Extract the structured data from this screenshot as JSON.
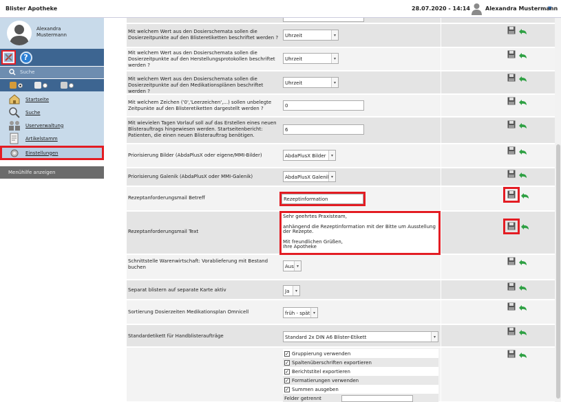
{
  "app_title": "Blister Apotheke",
  "header": {
    "datetime": "28.07.2020 - 14:14",
    "user_name": "Alexandra Mustermann"
  },
  "sidebar": {
    "profile_name_line1": "Alexandra",
    "profile_name_line2": "Mustermann",
    "search_label": "Suche",
    "nav": [
      {
        "label": "Startseite",
        "icon": "home-icon"
      },
      {
        "label": "Suche",
        "icon": "magnifier-icon"
      },
      {
        "label": "Userverwaltung",
        "icon": "users-icon"
      },
      {
        "label": "Artikelstamm",
        "icon": "article-icon"
      },
      {
        "label": "Einstellungen",
        "icon": "settings-icon"
      }
    ],
    "help_toggle": "Menühilfe anzeigen"
  },
  "settings": [
    {
      "label": "Mit welchem Wert aus den Dosierschemata sollen die Dosierzeitpunkte auf den Blisteretiketten beschriftet werden ?",
      "value": "Uhrzeit"
    },
    {
      "label": "Mit welchem Wert aus den Dosierschemata sollen die Dosierzeitpunkte auf den Herstellungsprotokollen beschriftet werden ?",
      "value": "Uhrzeit"
    },
    {
      "label": "Mit welchem Wert aus den Dosierschemata sollen die Dosierzeitpunkte auf den Medikationsplänen beschriftet werden ?",
      "value": "Uhrzeit"
    },
    {
      "label": "Mit welchem Zeichen ('0','Leerzeichen',...) sollen unbelegte Zeitpunkte auf den Blisteretiketten dargestellt werden ?",
      "value": "0"
    },
    {
      "label": "Mit wievielen Tagen Vorlauf soll auf das Erstellen eines neuen Blisterauftrags hingewiesen werden. Startseitenbericht: Patienten, die einen neuen Blisterauftrag benötigen.",
      "value": "6"
    },
    {
      "label": "Priorisierung Bilder (AbdaPlusX oder eigene/MMI-Bilder)",
      "value": "AbdaPlusX Bilder"
    },
    {
      "label": "Priorisierung Galenik (AbdaPlusX oder MMI-Galenik)",
      "value": "AbdaPlusX Galenik"
    },
    {
      "label": "Rezeptanforderungsmail Betreff",
      "value": "Rezeptinformation"
    },
    {
      "label": "Rezeptanforderungsmail Text",
      "value_lines": [
        "Sehr geehrtes Praxisteam,",
        "",
        "anhängend die Rezeptinformation mit der Bitte um Ausstellung der Rezepte.",
        "",
        "Mit freundlichen Grüßen,",
        "Ihre Apotheke"
      ]
    },
    {
      "label": "Schnittstelle Warenwirtschaft: Vorablieferung mit Bestand buchen",
      "value": "Aus"
    },
    {
      "label": "Separat blistern auf separate Karte aktiv",
      "value": "Ja"
    },
    {
      "label": "Sortierung Dosierzeiten Medikationsplan Omnicell",
      "value": "früh - spät"
    },
    {
      "label": "Standardetikett für Handblisteraufträge",
      "value": "Standard 2x DIN A6 Blister-Etikett"
    }
  ],
  "export_options": [
    {
      "label": "Gruppierung verwenden",
      "checked": true
    },
    {
      "label": "Spaltenüberschriften exportieren",
      "checked": true
    },
    {
      "label": "Berichtstitel exportieren",
      "checked": true
    },
    {
      "label": "Formatierungen verwenden",
      "checked": true
    },
    {
      "label": "Summen ausgeben",
      "checked": true
    }
  ],
  "separator_label": "Felder getrennt",
  "colors": {
    "accent_blue": "#3d6591",
    "highlight_red": "#e31c23",
    "sidebar_bg": "#c8daea"
  }
}
